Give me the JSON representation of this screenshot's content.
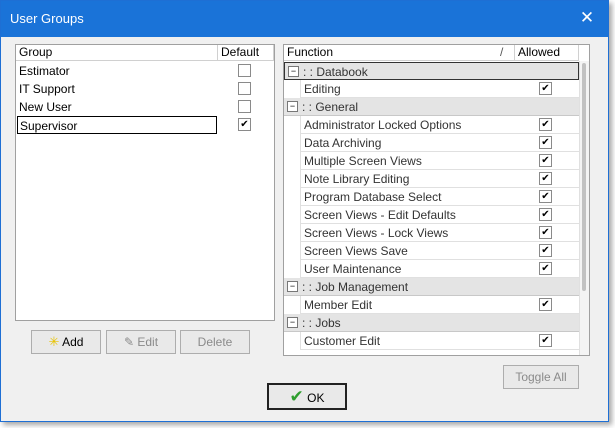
{
  "window": {
    "title": "User Groups",
    "close_glyph": "✕"
  },
  "groups_table": {
    "headers": {
      "group": "Group",
      "default": "Default"
    },
    "rows": [
      {
        "name": "Estimator",
        "default": false
      },
      {
        "name": "IT Support",
        "default": false
      },
      {
        "name": "New User",
        "default": false
      },
      {
        "name": "Supervisor",
        "default": true,
        "selected": true
      }
    ]
  },
  "functions_table": {
    "headers": {
      "function": "Function",
      "sort_glyph": "/",
      "allowed": "Allowed"
    },
    "sections": [
      {
        "label": ": : Databook",
        "items": [
          {
            "name": "Editing",
            "allowed": true
          }
        ]
      },
      {
        "label": ": : General",
        "items": [
          {
            "name": "Administrator Locked Options",
            "allowed": true
          },
          {
            "name": "Data Archiving",
            "allowed": true
          },
          {
            "name": "Multiple Screen Views",
            "allowed": true
          },
          {
            "name": "Note Library Editing",
            "allowed": true
          },
          {
            "name": "Program Database Select",
            "allowed": true
          },
          {
            "name": "Screen Views - Edit Defaults",
            "allowed": true
          },
          {
            "name": "Screen Views - Lock Views",
            "allowed": true
          },
          {
            "name": "Screen Views Save",
            "allowed": true
          },
          {
            "name": "User Maintenance",
            "allowed": true
          }
        ]
      },
      {
        "label": ": : Job Management",
        "items": [
          {
            "name": "Member Edit",
            "allowed": true
          }
        ]
      },
      {
        "label": ": : Jobs",
        "items": [
          {
            "name": "Customer Edit",
            "allowed": true
          }
        ]
      }
    ],
    "expander_glyph": "−"
  },
  "buttons": {
    "add": "Add",
    "edit": "Edit",
    "delete": "Delete",
    "toggle_all": "Toggle All",
    "ok": "OK"
  },
  "colors": {
    "titlebar": "#1a73d8",
    "ok_check": "#2e9e2e",
    "add_star": "#e8c300"
  }
}
